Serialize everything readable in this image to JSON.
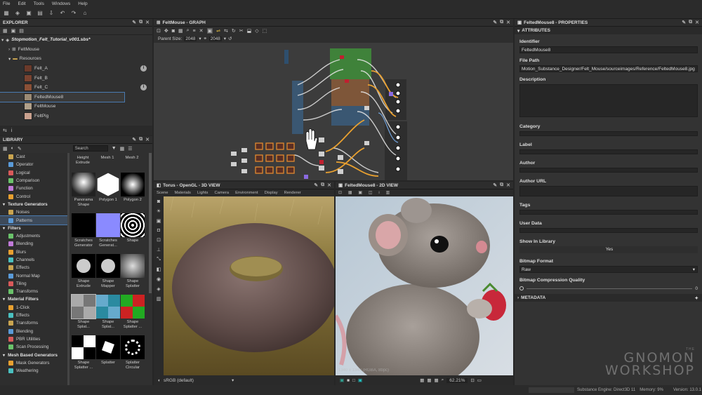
{
  "menu": [
    "File",
    "Edit",
    "Tools",
    "Windows",
    "Help"
  ],
  "explorer": {
    "title": "EXPLORER",
    "package": "Stopmotion_Felt_Tutorial_v001.sbs*",
    "graph": "FeltMouse",
    "folder": "Resources",
    "items": [
      {
        "label": "Felt_A",
        "color": "#6b3a2a",
        "info": true
      },
      {
        "label": "Felt_B",
        "color": "#7a4330",
        "info": false
      },
      {
        "label": "Felt_C",
        "color": "#8a5036",
        "info": true
      },
      {
        "label": "FeltedMouse8",
        "color": "#9b8a74",
        "info": false,
        "selected": true
      },
      {
        "label": "FeltMouse",
        "color": "#b0a08a",
        "info": false
      },
      {
        "label": "FeltPig",
        "color": "#c9a08e",
        "info": false
      }
    ]
  },
  "library": {
    "title": "LIBRARY",
    "search_placeholder": "Search",
    "rows": [
      {
        "label": "Cast",
        "cat": false
      },
      {
        "label": "Operator",
        "cat": false
      },
      {
        "label": "Logical",
        "cat": false
      },
      {
        "label": "Comparison",
        "cat": false
      },
      {
        "label": "Function",
        "cat": false
      },
      {
        "label": "Control",
        "cat": false
      },
      {
        "label": "Texture Generators",
        "cat": true
      },
      {
        "label": "Noises",
        "cat": false
      },
      {
        "label": "Patterns",
        "cat": false,
        "selected": true
      },
      {
        "label": "Filters",
        "cat": true
      },
      {
        "label": "Adjustments",
        "cat": false
      },
      {
        "label": "Blending",
        "cat": false
      },
      {
        "label": "Blurs",
        "cat": false
      },
      {
        "label": "Channels",
        "cat": false
      },
      {
        "label": "Effects",
        "cat": false
      },
      {
        "label": "Normal Map",
        "cat": false
      },
      {
        "label": "Tiling",
        "cat": false
      },
      {
        "label": "Transforms",
        "cat": false
      },
      {
        "label": "Material Filters",
        "cat": true
      },
      {
        "label": "1-Click",
        "cat": false
      },
      {
        "label": "Effects",
        "cat": false
      },
      {
        "label": "Transforms",
        "cat": false
      },
      {
        "label": "Blending",
        "cat": false
      },
      {
        "label": "PBR Utilities",
        "cat": false
      },
      {
        "label": "Scan Processing",
        "cat": false
      },
      {
        "label": "Mesh Based Generators",
        "cat": true
      },
      {
        "label": "Mask Generators",
        "cat": false
      },
      {
        "label": "Weathering",
        "cat": false
      }
    ],
    "top_labels": [
      "Height Extrude",
      "Mesh 1",
      "Mesh 2"
    ],
    "thumbs": [
      "Panorama Shape",
      "Polygon 1",
      "Polygon 2",
      "Scratches Generator",
      "Scratches Generat...",
      "Shape",
      "Shape Extrude",
      "Shape Mapper",
      "Shape Splatter",
      "Shape Splat...",
      "Shape Splat...",
      "Shape Splatter ...",
      "Shape Splatter ...",
      "Splatter",
      "Splatter Circular"
    ]
  },
  "graph": {
    "title": "FeltMouse - GRAPH",
    "parent_size_label": "Parent Size:",
    "size_a": "2048",
    "size_b": "2048"
  },
  "view3d": {
    "title": "Torus - OpenGL - 3D VIEW",
    "menu": [
      "Scene",
      "Materials",
      "Lights",
      "Camera",
      "Environment",
      "Display",
      "Renderer"
    ],
    "colorspace": "sRGB (default)"
  },
  "view2d": {
    "title": "FeltedMouse8 - 2D VIEW",
    "zoom": "62.21%",
    "info": "1340 x 1340 (RGBA, 8bpc)"
  },
  "props": {
    "title": "FeltedMouse8 - PROPERTIES",
    "attributes": "ATTRIBUTES",
    "identifier_label": "Identifier",
    "identifier": "FeltedMouse8",
    "filepath_label": "File Path",
    "filepath": "Motion_Substance_Designer/Felt_Mouse/sourceimages/Reference/FeltedMouse8.jpg",
    "description_label": "Description",
    "category_label": "Category",
    "label_label": "Label",
    "author_label": "Author",
    "authorurl_label": "Author URL",
    "tags_label": "Tags",
    "userdata_label": "User Data",
    "showlib_label": "Show In Library",
    "showlib_value": "Yes",
    "bitmapfmt_label": "Bitmap Format",
    "bitmapfmt_value": "Raw",
    "bmpq_label": "Bitmap Compression Quality",
    "bmpq_value": "0",
    "metadata": "METADATA"
  },
  "status": {
    "engine": "Substance Engine: Direct3D 11",
    "memory": "Memory: 9%",
    "version": "Version: 13.0.1"
  },
  "watermark": {
    "the": "THE",
    "line1": "GNOMON",
    "line2": "WORKSHOP"
  }
}
